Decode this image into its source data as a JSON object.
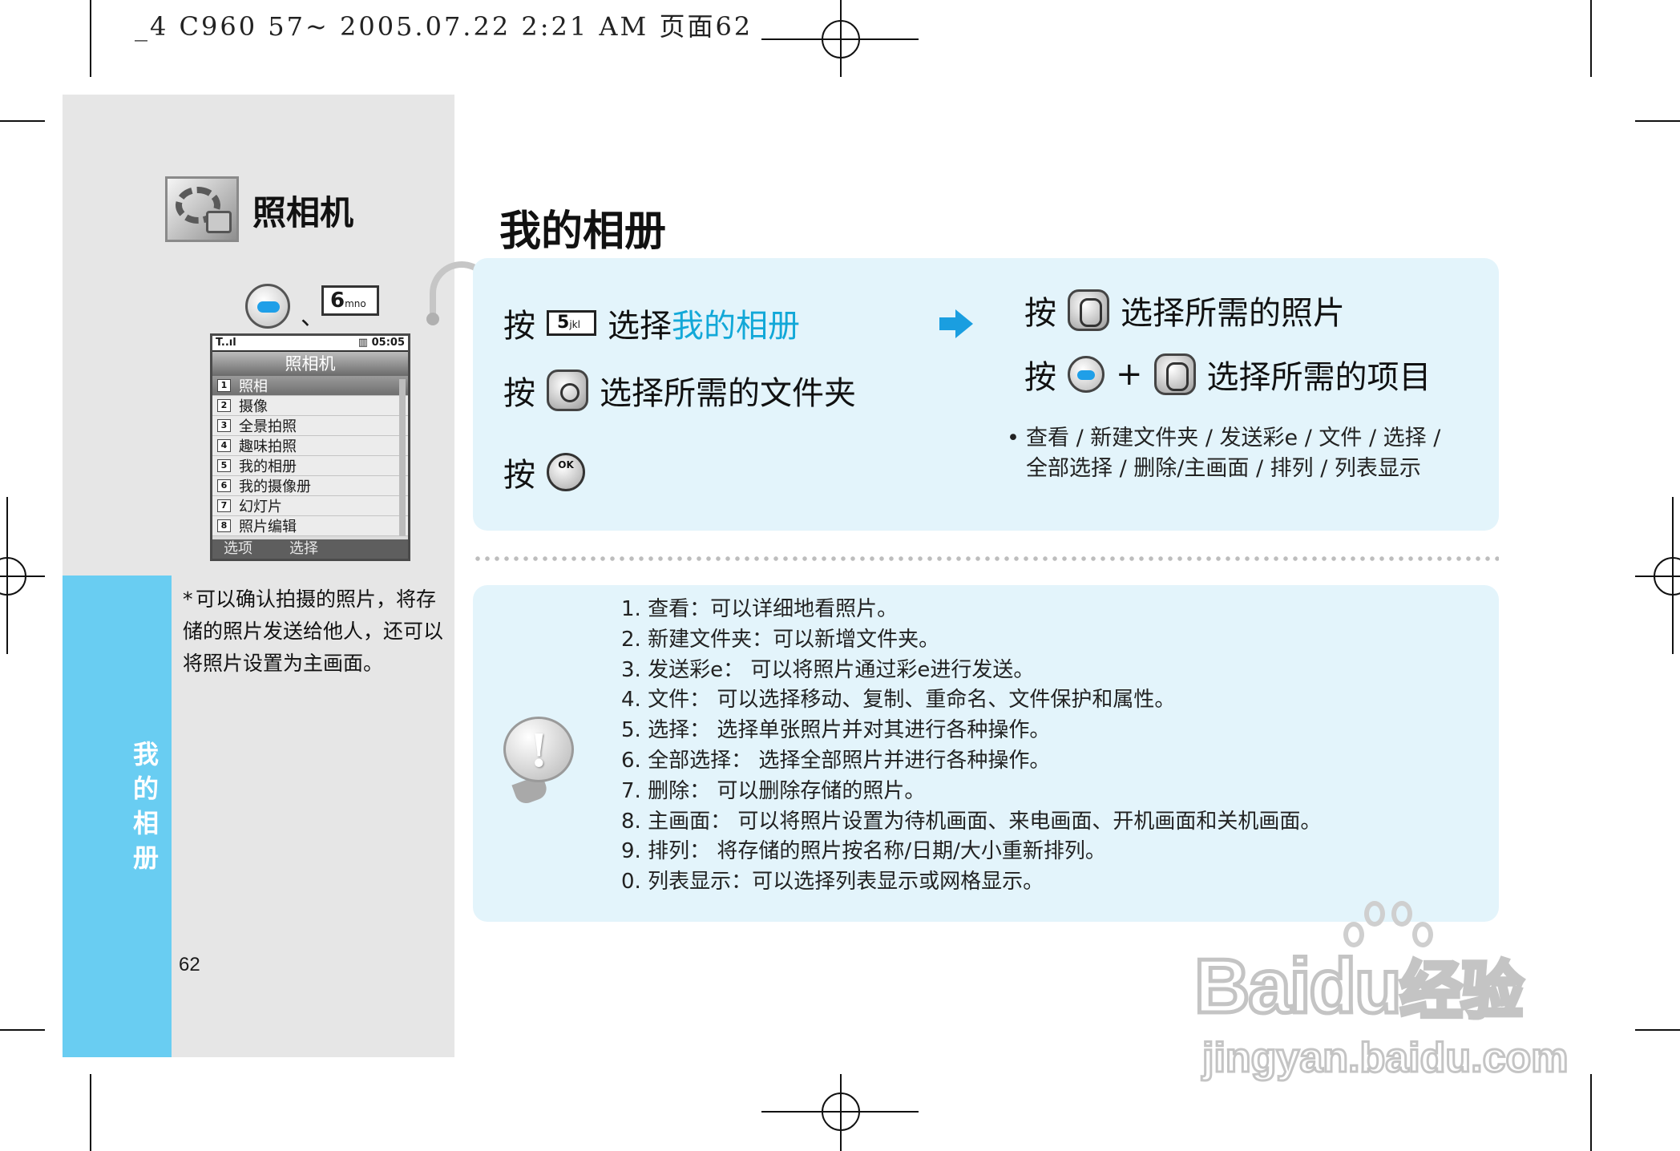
{
  "print_header": "_4 C960 57~ 2005.07.22 2:21 AM 页面62",
  "sidebar": {
    "section_title": "照相机",
    "shortcut_separator": "、",
    "shortcut_key": {
      "digit": "6",
      "letters": "mno"
    },
    "phone_screen": {
      "status_left": "T..ıl",
      "status_right": "▥ 05:05",
      "title": "照相机",
      "menu": [
        {
          "num": "1",
          "label": "照相",
          "selected": true
        },
        {
          "num": "2",
          "label": "摄像"
        },
        {
          "num": "3",
          "label": "全景拍照"
        },
        {
          "num": "4",
          "label": "趣味拍照"
        },
        {
          "num": "5",
          "label": "我的相册"
        },
        {
          "num": "6",
          "label": "我的摄像册"
        },
        {
          "num": "7",
          "label": "幻灯片"
        },
        {
          "num": "8",
          "label": "照片编辑"
        }
      ],
      "soft_left": "选项",
      "soft_right": "选择"
    },
    "note_star": "*",
    "note": "可以确认拍摄的照片，将存储的照片发送给他人，还可以将照片设置为主画面。",
    "band_title": "我的相册",
    "page_number": "62"
  },
  "main": {
    "title": "我的相册",
    "steps_left": [
      {
        "press": "按",
        "key_digit": "5",
        "key_letters": "jkl",
        "text": "选择",
        "highlight": "我的相册"
      },
      {
        "press": "按",
        "text": "选择所需的文件夹"
      },
      {
        "press": "按",
        "ok_label": "OK"
      }
    ],
    "steps_right": [
      {
        "press": "按",
        "text": "选择所需的照片"
      },
      {
        "press": "按",
        "plus": "+",
        "text": "选择所需的项目"
      }
    ],
    "options_bullet": "•",
    "options_line1": "查看 / 新建文件夹 / 发送彩e / 文件 / 选择 /",
    "options_line2": "全部选择 / 删除/主画面 / 排列 / 列表显示",
    "info_items": [
      "1. 查看：可以详细地看照片。",
      "2. 新建文件夹：可以新增文件夹。",
      "3. 发送彩e：  可以将照片通过彩e进行发送。",
      "4. 文件：  可以选择移动、复制、重命名、文件保护和属性。",
      "5. 选择：  选择单张照片并对其进行各种操作。",
      "6. 全部选择：  选择全部照片并进行各种操作。",
      "7. 删除：    可以删除存储的照片。",
      "8. 主画面：  可以将照片设置为待机画面、来电画面、开机画面和关机画面。",
      "9. 排列：  将存储的照片按名称/日期/大小重新排列。",
      "0. 列表显示：可以选择列表显示或网格显示。"
    ]
  },
  "watermark": {
    "brand": "Baidu",
    "brand_cn": "经验",
    "site": "jingyan.baidu.com"
  },
  "colors": {
    "accent_blue": "#69cdf2",
    "highlight_text": "#12a8d8",
    "panel_bg": "#e3f4fb",
    "sidebar_bg": "#e6e6e6"
  }
}
